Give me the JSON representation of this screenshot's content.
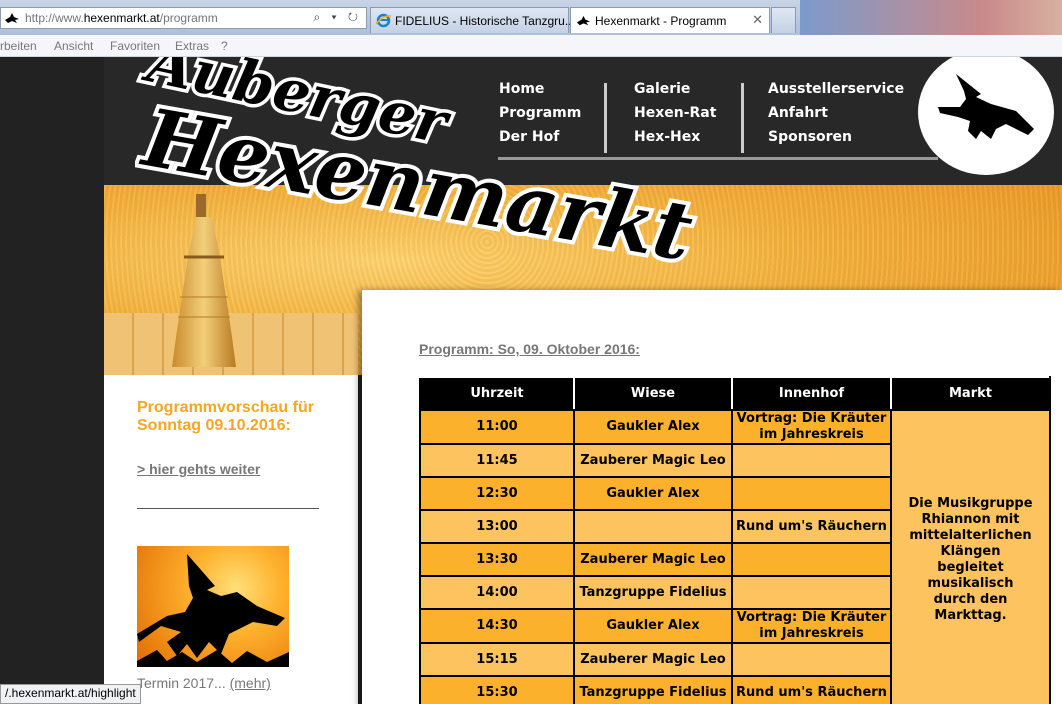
{
  "browser": {
    "address_prefix": "http://www.",
    "address_domain": "hexenmarkt.at",
    "address_suffix": "/programm",
    "address_icons": "⌕ ▾ ↻",
    "tabs": [
      {
        "label": "FIDELIUS - Historische Tanzgru..."
      },
      {
        "label": "Hexenmarkt - Programm",
        "close": "✕"
      }
    ],
    "menu": [
      "rbeiten",
      "Ansicht",
      "Favoriten",
      "Extras",
      "?"
    ],
    "status_url": "/.hexenmarkt.at/highlight"
  },
  "site": {
    "logo_line1": "Auberger",
    "logo_line2": "Hexenmarkt",
    "nav": {
      "col1": [
        "Home",
        "Programm",
        "Der Hof"
      ],
      "col2": [
        "Galerie",
        "Hexen-Rat",
        "Hex-Hex"
      ],
      "col3": [
        "Ausstellerservice",
        "Anfahrt",
        "Sponsoren"
      ]
    }
  },
  "sidebar": {
    "title": "Programmvorschau für Sonntag 09.10.2016:",
    "link": "> hier gehts weiter",
    "termin_text": "Termin 2017...",
    "termin_link": "(mehr)"
  },
  "main": {
    "heading": "Programm: So, 09. Oktober 2016:",
    "columns": [
      "Uhrzeit",
      "Wiese",
      "Innenhof",
      "Markt"
    ],
    "rows": [
      {
        "time": "11:00",
        "wiese": "Gaukler Alex",
        "innenhof": "Vortrag: Die Kräuter im Jahreskreis"
      },
      {
        "time": "11:45",
        "wiese": "Zauberer Magic Leo",
        "innenhof": ""
      },
      {
        "time": "12:30",
        "wiese": "Gaukler Alex",
        "innenhof": ""
      },
      {
        "time": "13:00",
        "wiese": "",
        "innenhof": "Rund um's Räuchern"
      },
      {
        "time": "13:30",
        "wiese": "Zauberer Magic Leo",
        "innenhof": ""
      },
      {
        "time": "14:00",
        "wiese": "Tanzgruppe Fidelius",
        "innenhof": ""
      },
      {
        "time": "14:30",
        "wiese": "Gaukler Alex",
        "innenhof": "Vortrag: Die Kräuter im Jahreskreis"
      },
      {
        "time": "15:15",
        "wiese": "Zauberer Magic Leo",
        "innenhof": ""
      },
      {
        "time": "15:30",
        "wiese": "Tanzgruppe Fidelius",
        "innenhof": "Rund um's Räuchern"
      }
    ],
    "markt": "Die Musikgruppe Rhiannon mit mittelalterlichen Klängen begleitet musikalisch durch den Markttag."
  },
  "colors": {
    "row_dark": "#fbb12c",
    "row_light": "#fcc35e",
    "accent": "#f5a623"
  }
}
